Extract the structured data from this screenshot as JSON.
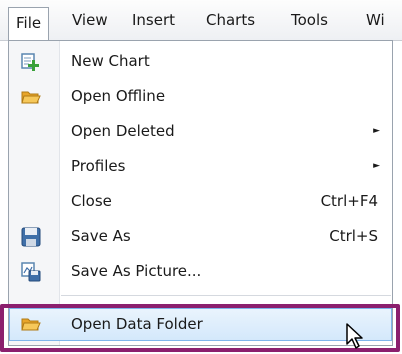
{
  "menubar": {
    "items": [
      "File",
      "View",
      "Insert",
      "Charts",
      "Tools",
      "Wi"
    ]
  },
  "menu": {
    "items": [
      {
        "label": "New Chart",
        "icon": "new-chart-icon"
      },
      {
        "label": "Open Offline",
        "icon": "open-folder-icon"
      },
      {
        "label": "Open Deleted",
        "submenu": true
      },
      {
        "label": "Profiles",
        "submenu": true
      },
      {
        "label": "Close",
        "shortcut": "Ctrl+F4"
      },
      {
        "label": "Save As",
        "shortcut": "Ctrl+S",
        "icon": "save-icon"
      },
      {
        "label": "Save As Picture...",
        "icon": "save-picture-icon"
      },
      {
        "label": "Open Data Folder",
        "icon": "data-folder-icon",
        "highlighted": true
      }
    ],
    "submenu_arrow": "►"
  },
  "colors": {
    "highlight_frame": "#8b1f6e",
    "hover_fill": "#d3e8fb"
  }
}
